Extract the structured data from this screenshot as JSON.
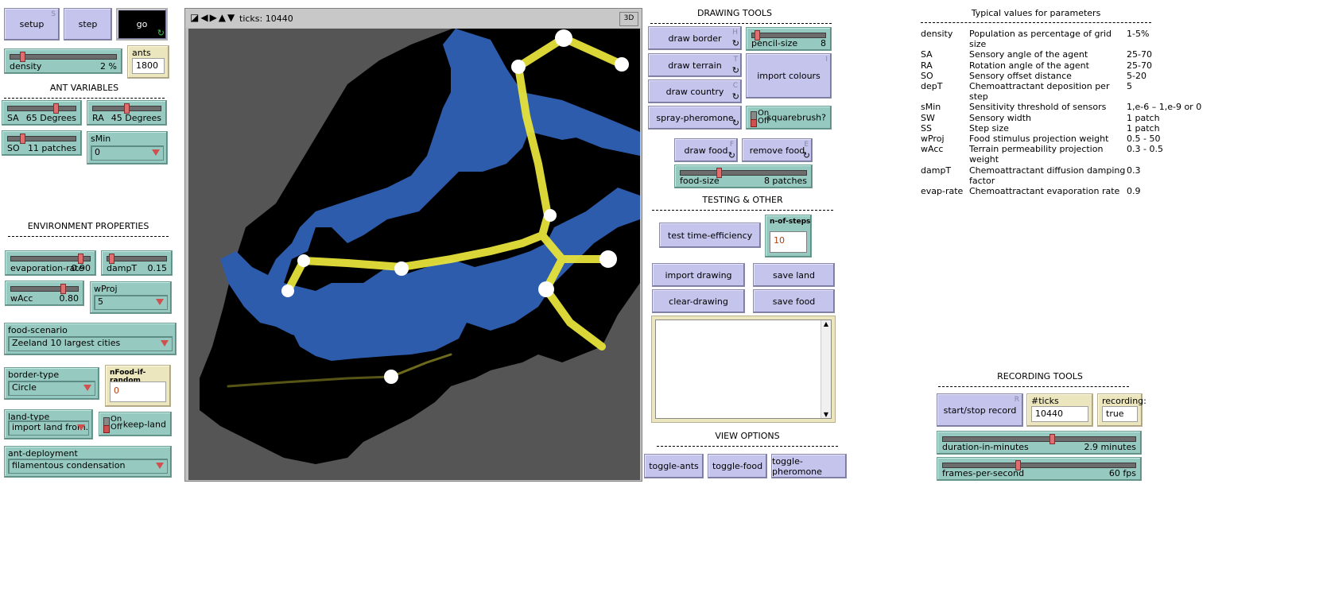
{
  "view": {
    "ticks_label": "ticks: 10440",
    "btn_3d": "3D"
  },
  "buttons": {
    "setup": {
      "label": "setup",
      "key": "S"
    },
    "step": {
      "label": "step"
    },
    "go": {
      "label": "go"
    },
    "draw_border": {
      "label": "draw border",
      "key": "H"
    },
    "draw_terrain": {
      "label": "draw terrain",
      "key": "T"
    },
    "draw_country": {
      "label": "draw country",
      "key": "C"
    },
    "spray_pheromone": {
      "label": "spray-pheromone"
    },
    "import_colours": {
      "label": "import colours",
      "key": "I"
    },
    "draw_food": {
      "label": "draw food",
      "key": "F"
    },
    "remove_food": {
      "label": "remove food",
      "key": "E"
    },
    "test_time_efficiency": {
      "label": "test time-efficiency"
    },
    "import_drawing": {
      "label": "import drawing"
    },
    "save_land": {
      "label": "save land"
    },
    "clear_drawing": {
      "label": "clear-drawing"
    },
    "save_food": {
      "label": "save food"
    },
    "toggle_ants": {
      "label": "toggle-ants"
    },
    "toggle_food": {
      "label": "toggle-food"
    },
    "toggle_pheromone": {
      "label": "toggle-pheromone"
    },
    "start_stop_record": {
      "label": "start/stop record",
      "key": "R"
    }
  },
  "headings": {
    "ant_variables": "ANT VARIABLES",
    "environment_properties": "ENVIRONMENT PROPERTIES",
    "drawing_tools": "DRAWING TOOLS",
    "testing_other": "TESTING & OTHER",
    "view_options": "VIEW OPTIONS",
    "recording_tools": "RECORDING TOOLS",
    "typical_values": "Typical values for parameters"
  },
  "sliders": {
    "density": {
      "label": "density",
      "value": "2 %",
      "fraction": 0.1
    },
    "sa": {
      "label": "SA",
      "value": "65 Degrees",
      "fraction": 0.72
    },
    "ra": {
      "label": "RA",
      "value": "45 Degrees",
      "fraction": 0.5
    },
    "so": {
      "label": "SO",
      "value": "11 patches",
      "fraction": 0.2
    },
    "evaporation_rate": {
      "label": "evaporation-rate",
      "value": "0.90",
      "fraction": 0.9
    },
    "dampt": {
      "label": "dampT",
      "value": "0.15",
      "fraction": 0.05
    },
    "wacc": {
      "label": "wAcc",
      "value": "0.80",
      "fraction": 0.8
    },
    "pencil_size": {
      "label": "pencil-size",
      "value": "8",
      "fraction": 0.05
    },
    "food_size": {
      "label": "food-size",
      "value": "8 patches",
      "fraction": 0.3
    },
    "duration": {
      "label": "duration-in-minutes",
      "value": "2.9 minutes",
      "fraction": 0.57
    },
    "fps": {
      "label": "frames-per-second",
      "value": "60 fps",
      "fraction": 0.39
    }
  },
  "monitors": {
    "ants": {
      "label": "ants",
      "value": "1800"
    },
    "ticks_recording": {
      "label": "#ticks recording:",
      "value": "10440"
    },
    "recording": {
      "label": "recording:",
      "value": "true"
    }
  },
  "choosers": {
    "smin": {
      "label": "sMin",
      "value": "0"
    },
    "wproj": {
      "label": "wProj",
      "value": "5"
    },
    "food_scenario": {
      "label": "food-scenario",
      "value": "Zeeland 10 largest cities"
    },
    "border_type": {
      "label": "border-type",
      "value": "Circle"
    },
    "land_type": {
      "label": "land-type",
      "value": "import land from..."
    },
    "ant_deployment": {
      "label": "ant-deployment",
      "value": "filamentous condensation"
    }
  },
  "inputs": {
    "nfood_if_random": {
      "label": "nFood-if-random",
      "value": "0"
    },
    "n_of_steps": {
      "label": "n-of-steps",
      "value": "10"
    }
  },
  "switches": {
    "squarebrush": {
      "label": "squarebrush?",
      "on": "On",
      "off": "Off"
    },
    "keep_land": {
      "label": "keep-land",
      "on": "On",
      "off": "Off"
    }
  },
  "params": [
    {
      "name": "density",
      "desc": "Population as percentage of grid size",
      "value": "1-5%"
    },
    {
      "name": "SA",
      "desc": "Sensory angle of the agent",
      "value": "25-70"
    },
    {
      "name": "RA",
      "desc": "Rotation angle of the agent",
      "value": "25-70"
    },
    {
      "name": "SO",
      "desc": "Sensory offset distance",
      "value": "5-20"
    },
    {
      "name": "depT",
      "desc": "Chemoattractant deposition per step",
      "value": "5"
    },
    {
      "name": "sMin",
      "desc": "Sensitivity threshold of sensors",
      "value": "1,e-6 – 1,e-9 or 0"
    },
    {
      "name": "SW",
      "desc": "Sensory width",
      "value": "1 patch"
    },
    {
      "name": "SS",
      "desc": "Step size",
      "value": "1 patch"
    },
    {
      "name": "wProj",
      "desc": "Food stimulus projection weight",
      "value": "0.5 - 50"
    },
    {
      "name": "wAcc",
      "desc": "Terrain permeability projection weight",
      "value": "0.3 - 0.5"
    },
    {
      "name": "dampT",
      "desc": "Chemoattractant diffusion damping factor",
      "value": "0.3"
    },
    {
      "name": "evap-rate",
      "desc": "Chemoattractant evaporation rate",
      "value": "0.9"
    }
  ],
  "colors": {
    "button": "#c4c4ec",
    "slider": "#96cac0",
    "monitor": "#ece6be",
    "land": "#000000",
    "water": "#2e5cad",
    "outside": "#555555",
    "pheromone": "#e6e23a",
    "food": "#ffffff"
  }
}
